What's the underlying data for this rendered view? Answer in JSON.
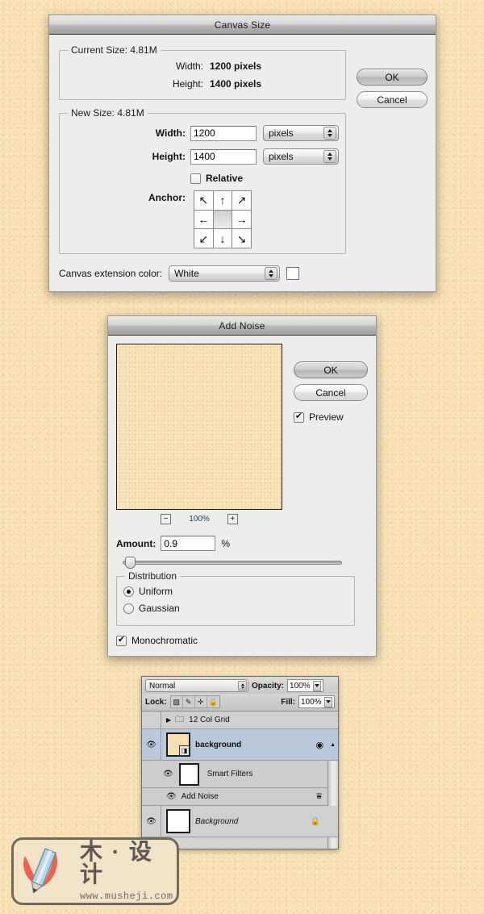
{
  "canvas_size_dialog": {
    "title": "Canvas Size",
    "current_size": {
      "legend": "Current Size: 4.81M",
      "width_label": "Width:",
      "width_value": "1200 pixels",
      "height_label": "Height:",
      "height_value": "1400 pixels"
    },
    "new_size": {
      "legend": "New Size: 4.81M",
      "width_label": "Width:",
      "width_value": "1200",
      "width_unit": "pixels",
      "height_label": "Height:",
      "height_value": "1400",
      "height_unit": "pixels",
      "relative_label": "Relative",
      "relative_checked": false,
      "anchor_label": "Anchor:"
    },
    "extension_color_label": "Canvas extension color:",
    "extension_color_value": "White",
    "ok_label": "OK",
    "cancel_label": "Cancel"
  },
  "add_noise_dialog": {
    "title": "Add Noise",
    "ok_label": "OK",
    "cancel_label": "Cancel",
    "preview_label": "Preview",
    "preview_checked": true,
    "zoom_out_label": "−",
    "zoom_in_label": "+",
    "zoom_level": "100%",
    "amount_label": "Amount:",
    "amount_value": "0.9",
    "amount_unit": "%",
    "distribution": {
      "legend": "Distribution",
      "options": [
        {
          "label": "Uniform",
          "selected": true
        },
        {
          "label": "Gaussian",
          "selected": false
        }
      ]
    },
    "monochromatic_label": "Monochromatic",
    "monochromatic_checked": true
  },
  "layers_panel": {
    "blend_mode": "Normal",
    "opacity_label": "Opacity:",
    "opacity_value": "100%",
    "lock_label": "Lock:",
    "fill_label": "Fill:",
    "fill_value": "100%",
    "lock_icons": [
      "transparency-lock-icon",
      "pixels-lock-icon",
      "position-lock-icon",
      "all-lock-icon"
    ],
    "rows": [
      {
        "name": "12 Col Grid",
        "type": "group",
        "visible": false,
        "selected": false
      },
      {
        "name": "background",
        "type": "smart-object",
        "visible": true,
        "selected": true
      },
      {
        "name": "Smart Filters",
        "type": "smart-filters",
        "visible": true,
        "selected": false
      },
      {
        "name": "Add Noise",
        "type": "filter",
        "visible": true,
        "selected": false
      },
      {
        "name": "Background",
        "type": "background",
        "visible": true,
        "selected": false,
        "locked": true
      }
    ]
  },
  "watermark": {
    "chinese": "木 · 设计",
    "url": "www.musheji.com"
  }
}
